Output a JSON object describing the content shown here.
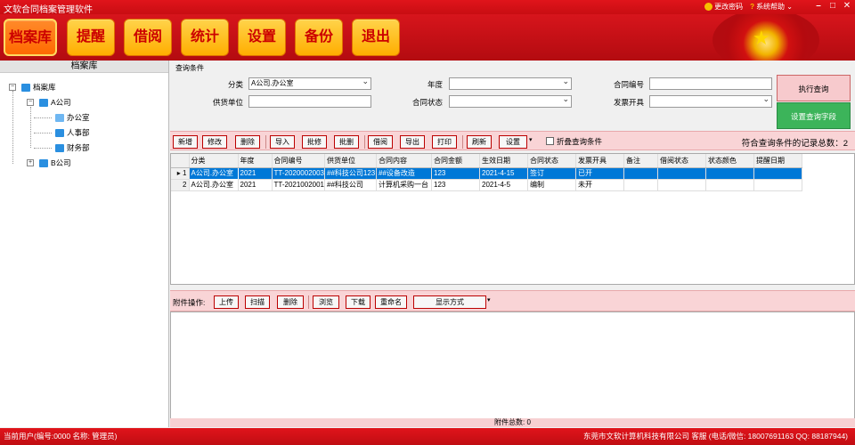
{
  "window": {
    "title": "文软合同档案管理软件",
    "change_password": "更改密码",
    "help": "系统帮助"
  },
  "menu": [
    "档案库",
    "提醒",
    "借阅",
    "统计",
    "设置",
    "备份",
    "退出"
  ],
  "tree": {
    "header": "档案库",
    "root": "档案库",
    "company_a": "A公司",
    "dept1": "办公室",
    "dept2": "人事部",
    "dept3": "财务部",
    "company_b": "B公司"
  },
  "query": {
    "title": "查询条件",
    "category_label": "分类",
    "category_value": "A公司.办公室",
    "year_label": "年度",
    "year_value": "",
    "contract_no_label": "合同编号",
    "contract_no_value": "",
    "supplier_label": "供货单位",
    "supplier_value": "",
    "status_label": "合同状态",
    "status_value": "",
    "invoice_label": "发票开具",
    "invoice_value": "",
    "execute_btn": "执行查询",
    "fields_btn": "设置查询字段"
  },
  "toolbar": {
    "buttons": [
      "新增",
      "修改",
      "删除",
      "导入",
      "批修",
      "批删",
      "借阅",
      "导出",
      "打印",
      "刷新",
      "设置"
    ],
    "collapse": "折叠查询条件",
    "count_text": "符合查询条件的记录总数：2"
  },
  "grid": {
    "columns": [
      "分类",
      "年度",
      "合同编号",
      "供货单位",
      "合同内容",
      "合同金额",
      "生效日期",
      "合同状态",
      "发票开具",
      "备注",
      "借阅状态",
      "状态颜色",
      "提醒日期"
    ],
    "rows": [
      [
        "1",
        "A公司.办公室",
        "2021",
        "TT-2020002003",
        "##科技公司123",
        "##设备改造",
        "123",
        "2021-4-15",
        "签订",
        "已开",
        "",
        "",
        "",
        ""
      ],
      [
        "2",
        "A公司.办公室",
        "2021",
        "TT-2021002001",
        "##科技公司",
        "计算机采购一台",
        "123",
        "2021-4-5",
        "编制",
        "未开",
        "",
        "",
        "",
        ""
      ]
    ]
  },
  "attach": {
    "label": "附件操作:",
    "buttons": [
      "上传",
      "扫描",
      "删除",
      "浏览",
      "下载",
      "重命名"
    ],
    "display_mode": "显示方式",
    "total": "附件总数: 0"
  },
  "status": {
    "user": "当前用户(编号:0000 名称: 管理员)",
    "company": "东莞市文软计算机科技有限公司 客服 (电话/微信: 18007691163 QQ: 88187944)"
  },
  "colors": {
    "brand_red": "#d7151c",
    "menu_gold": "#ffb300",
    "select_blue": "#0078d7"
  }
}
